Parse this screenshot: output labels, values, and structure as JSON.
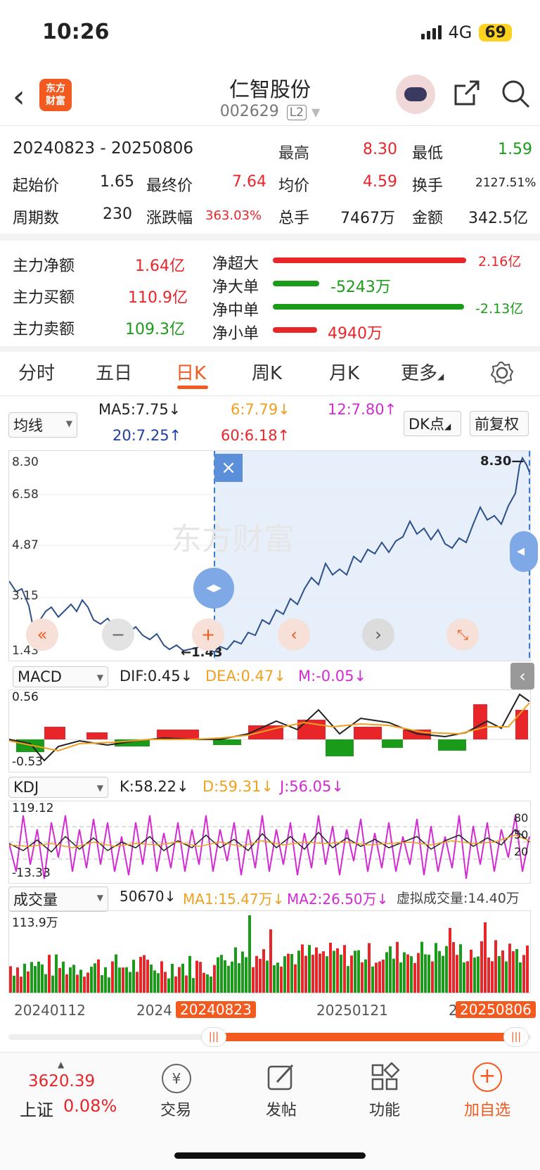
{
  "status": {
    "time": "10:26",
    "network": "4G",
    "battery": "69"
  },
  "header": {
    "title": "仁智股份",
    "code": "002629",
    "level": "L2",
    "logo_text": "东方财富"
  },
  "period": {
    "range": "20240823 - 20250806",
    "high_label": "最高",
    "high": "8.30",
    "low_label": "最低",
    "low": "1.59",
    "start_label": "起始价",
    "start": "1.65",
    "end_label": "最终价",
    "end": "7.64",
    "avg_label": "均价",
    "avg": "4.59",
    "turnover_label": "换手",
    "turnover": "2127.51%",
    "days_label": "周期数",
    "days": "230",
    "change_label": "涨跌幅",
    "change": "363.03%",
    "vol_label": "总手",
    "vol": "7467万",
    "amount_label": "金额",
    "amount": "342.5亿"
  },
  "flow": {
    "net_label": "主力净额",
    "net": "1.64亿",
    "buy_label": "主力买额",
    "buy": "110.9亿",
    "sell_label": "主力卖额",
    "sell": "109.3亿",
    "rows": [
      {
        "label": "净超大",
        "value": "2.16亿",
        "fraction": 1.0,
        "color": "#e8262a"
      },
      {
        "label": "净大单",
        "value": "-5243万",
        "fraction": 0.24,
        "color": "#1a9c1a"
      },
      {
        "label": "净中单",
        "value": "-2.13亿",
        "fraction": 0.99,
        "color": "#1a9c1a"
      },
      {
        "label": "净小单",
        "value": "4940万",
        "fraction": 0.23,
        "color": "#e8262a"
      }
    ]
  },
  "tabs": [
    "分时",
    "五日",
    "日K",
    "周K",
    "月K",
    "更多"
  ],
  "active_tab": "日K",
  "ma": {
    "selector": "均线",
    "ma5": "MA5:7.75↓",
    "ma6": "6:7.79↓",
    "ma12": "12:7.80↑",
    "ma20": "20:7.25↑",
    "ma60": "60:6.18↑",
    "dk_button": "DK点",
    "adjust_button": "前复权"
  },
  "kline": {
    "y_labels": [
      "8.30",
      "6.58",
      "4.87",
      "3.15",
      "1.43"
    ],
    "max_label": "8.30",
    "min_label": "1.43",
    "watermark": "东方财富"
  },
  "macd": {
    "selector": "MACD",
    "dif": "DIF:0.45↓",
    "dea": "DEA:0.47↓",
    "m": "M:-0.05↓",
    "top": "0.56",
    "bottom": "-0.53"
  },
  "kdj": {
    "selector": "KDJ",
    "k": "K:58.22↓",
    "d": "D:59.31↓",
    "j": "J:56.05↓",
    "top": "119.12",
    "bottom": "-13.33",
    "r1": "80",
    "r2": "50",
    "r3": "20"
  },
  "volume": {
    "selector": "成交量",
    "vol": "50670↓",
    "ma1": "MA1:15.47万↓",
    "ma2": "MA2:26.50万↓",
    "virtual": "虚拟成交量:14.40万",
    "top": "113.9万"
  },
  "dates": {
    "d1": "20240112",
    "d2": "2024",
    "d3": "20250121",
    "d4": "2",
    "sel_start": "20240823",
    "sel_end": "20250806"
  },
  "colors": {
    "accent": "#f25a1f",
    "up": "#e8262a",
    "down": "#1a9c1a"
  },
  "bottom": {
    "index_value": "3620.39",
    "index_name": "上证",
    "index_change": "0.08%",
    "nav": [
      "交易",
      "发帖",
      "功能",
      "加自选"
    ]
  }
}
